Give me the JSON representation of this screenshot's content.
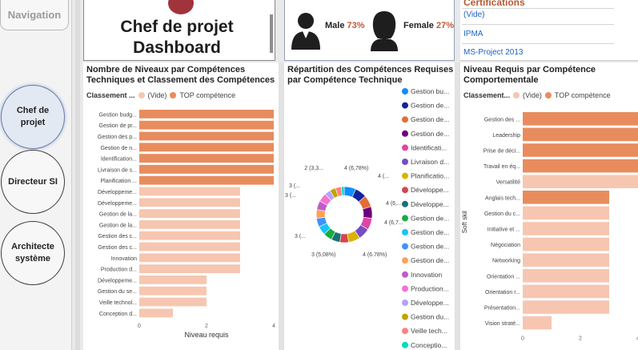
{
  "navigation": {
    "title": "Navigation",
    "buttons": [
      {
        "label": "Chef de projet",
        "active": true
      },
      {
        "label": "Directeur SI",
        "active": false
      },
      {
        "label": "Architecte système",
        "active": false
      }
    ]
  },
  "header": {
    "dashboard_title": "Chef de projet Dashboard",
    "gender": {
      "male_label": "Male",
      "male_pct": "73%",
      "female_label": "Female",
      "female_pct": "27%"
    },
    "certifications": {
      "title": "Certifications",
      "items": [
        "(Vide)",
        "IPMA",
        "MS-Project 2013"
      ]
    }
  },
  "colors": {
    "top": "#e88c5e",
    "vide": "#f6c6b0",
    "brand": "#b55a34"
  },
  "charts": [
    {
      "chart_data": {
        "type": "bar",
        "orientation": "horizontal",
        "title": "Nombre de Niveaux par Compétences Techniques et Classement des Compétences",
        "xlabel": "Niveau requis",
        "legend_title": "Classement ...",
        "legend": [
          "(Vide)",
          "TOP compétence"
        ],
        "xlim": [
          0,
          4
        ],
        "xticks": [
          "0",
          "2",
          "4"
        ],
        "categories": [
          "Gestion budg...",
          "Gestion de pr...",
          "Gestion des p...",
          "Gestion de n...",
          "Identification...",
          "Livraison de s...",
          "Planification ...",
          "Développeme...",
          "Développeme...",
          "Gestion de la...",
          "Gestion de la...",
          "Gestion des c...",
          "Gestion des c...",
          "Innovation",
          "Production d...",
          "Développeme...",
          "Gestion du se...",
          "Veille technol...",
          "Conception d..."
        ],
        "values": [
          4,
          4,
          4,
          4,
          4,
          4,
          4,
          3,
          3,
          3,
          3,
          3,
          3,
          3,
          3,
          2,
          2,
          2,
          1
        ],
        "classes": [
          "TOP compétence",
          "TOP compétence",
          "TOP compétence",
          "TOP compétence",
          "TOP compétence",
          "TOP compétence",
          "TOP compétence",
          "(Vide)",
          "(Vide)",
          "(Vide)",
          "(Vide)",
          "(Vide)",
          "(Vide)",
          "(Vide)",
          "(Vide)",
          "(Vide)",
          "(Vide)",
          "(Vide)",
          "(Vide)"
        ]
      }
    },
    {
      "chart_data": {
        "type": "pie",
        "variant": "donut",
        "title": "Répartition des Compétences Requises par Compétence Technique",
        "legend": [
          {
            "name": "Gestion bu...",
            "color": "#118dff"
          },
          {
            "name": "Gestion de...",
            "color": "#12239e"
          },
          {
            "name": "Gestion de...",
            "color": "#e66c37"
          },
          {
            "name": "Gestion de...",
            "color": "#6b007b"
          },
          {
            "name": "Identificati...",
            "color": "#e044a7"
          },
          {
            "name": "Livraison d...",
            "color": "#744ec2"
          },
          {
            "name": "Planificatio...",
            "color": "#d9b300"
          },
          {
            "name": "Développe...",
            "color": "#d64550"
          },
          {
            "name": "Développe...",
            "color": "#197278"
          },
          {
            "name": "Gestion de...",
            "color": "#1aab40"
          },
          {
            "name": "Gestion de...",
            "color": "#15c6f4"
          },
          {
            "name": "Gestion de...",
            "color": "#4092ff"
          },
          {
            "name": "Gestion de...",
            "color": "#ffa058"
          },
          {
            "name": "Innovation",
            "color": "#be5dc9"
          },
          {
            "name": "Production...",
            "color": "#f472d0"
          },
          {
            "name": "Développe...",
            "color": "#b5a1ff"
          },
          {
            "name": "Gestion du...",
            "color": "#c4a200"
          },
          {
            "name": "Veille tech...",
            "color": "#ff8080"
          },
          {
            "name": "Conceptio...",
            "color": "#00dbbc"
          }
        ],
        "values": [
          4,
          4,
          4,
          4,
          4,
          4,
          4,
          3,
          3,
          3,
          3,
          3,
          3,
          3,
          3,
          2,
          2,
          2,
          1
        ],
        "data_labels": [
          "4 (6,78%)",
          "4 (...",
          "4 (6,...",
          "4 (6,7...",
          "4 (6.78%)",
          "3 (5,08%)",
          "3 (...",
          "3 (...",
          "3 (...",
          "2 (3,3..."
        ]
      }
    },
    {
      "chart_data": {
        "type": "bar",
        "orientation": "horizontal",
        "title": "Niveau Requis par Compétence Comportementale",
        "ylabel": "Soft skil",
        "legend_title": "Classement...",
        "legend": [
          "(Vide)",
          "TOP compétence"
        ],
        "xlim": [
          0,
          4
        ],
        "xticks": [
          "0",
          "2",
          "4"
        ],
        "categories": [
          "Gestion des ...",
          "Leadership",
          "Prise de déci...",
          "Travail en éq...",
          "Versatilité",
          "Anglais tech...",
          "Gestion du c...",
          "Initiative et ...",
          "Négociation",
          "Networking",
          "Orientation ...",
          "Orientation r...",
          "Présentation...",
          "Vision straté..."
        ],
        "values": [
          4,
          4,
          4,
          4,
          4,
          3,
          3,
          3,
          3,
          3,
          3,
          3,
          3,
          1
        ],
        "classes": [
          "TOP compétence",
          "TOP compétence",
          "TOP compétence",
          "TOP compétence",
          "(Vide)",
          "TOP compétence",
          "(Vide)",
          "(Vide)",
          "(Vide)",
          "(Vide)",
          "(Vide)",
          "(Vide)",
          "(Vide)",
          "(Vide)"
        ]
      }
    }
  ]
}
